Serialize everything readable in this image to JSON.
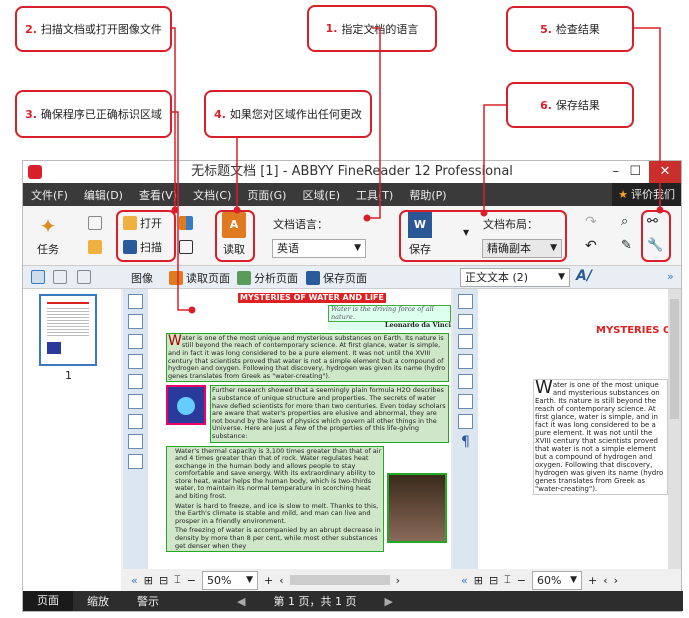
{
  "callouts": [
    {
      "num": "1.",
      "text": "指定文档的语言"
    },
    {
      "num": "2.",
      "text": "扫描文档或打开图像文件"
    },
    {
      "num": "3.",
      "text": "确保程序已正确标识区域"
    },
    {
      "num": "4.",
      "text": "如果您对区域作出任何更改"
    },
    {
      "num": "5.",
      "text": "检查结果"
    },
    {
      "num": "6.",
      "text": "保存结果"
    }
  ],
  "window": {
    "title": "无标题文档 [1] - ABBYY FineReader 12 Professional",
    "minimize": "–",
    "maximize": "☐",
    "close": "✕"
  },
  "menu": {
    "items": [
      "文件(F)",
      "编辑(D)",
      "查看(V)",
      "文档(C)",
      "页面(G)",
      "区域(E)",
      "工具(T)",
      "帮助(P)"
    ],
    "rate": "评价我们"
  },
  "toolbar": {
    "task": "任务",
    "open": "打开",
    "scan": "扫描",
    "read": "读取",
    "lang_label": "文档语言：",
    "lang_value": "英语",
    "save": "保存",
    "layout_label": "文档布局：",
    "layout_value": "精确副本"
  },
  "image_toolbar": {
    "image": "图像",
    "read_page": "读取页面",
    "analyze_page": "分析页面",
    "save_page": "保存页面"
  },
  "text_toolbar": {
    "style": "正文文本 (2)",
    "more": "»"
  },
  "thumb": {
    "page_number": "1"
  },
  "document": {
    "title": "MYSTERIES OF WATER AND LIFE",
    "quote": "Water is the driving force of all nature.",
    "author": "Leonardo da Vinci",
    "drop_cap": "W",
    "p1": "ater is one of the most unique and mysterious substances on Earth. Its nature is still beyond the reach of contemporary science. At first glance, water is simple, and in fact it was long considered to be a pure element. It was not until the XVIII century that scientists proved that water is not a simple element but a compound of hydrogen and oxygen. Following that discovery, hydrogen was given its name (hydro genes translates from Greek as \"water-creating\").",
    "p2": "Further research showed that a seemingly plain formula H2O describes a substance of unique structure and properties. The secrets of water have defied scientists for more than two centuries. Even today scholars are aware that water's properties are elusive and abnormal, they are not bound by the laws of physics which govern all other things in the Universe. Here are just a few of the properties of this life-giving substance:",
    "b1": "Water's thermal capacity is 3,100 times greater than that of air and 4 times greater than that of rock. Water regulates heat exchange in the human body and allows people to stay comfortable and save energy. With its extraordinary ability to store heat, water helps the human body, which is two-thirds water, to maintain its normal temperature in scorching heat and biting frost.",
    "b2": "Water is hard to freeze, and ice is slow to melt. Thanks to this, the Earth's climate is stable and mild, and man can live and prosper in a friendly environment.",
    "b3": "The freezing of water is accompanied by an abrupt decrease in density by more than 8 per cent, while most other substances get denser when they"
  },
  "text_view": {
    "title": "MYSTERIES O"
  },
  "zoom_left": "50%",
  "zoom_right": "60%",
  "status": {
    "tabs": [
      "页面",
      "缩放",
      "警示"
    ],
    "page_info": "第 1 页，共 1 页"
  }
}
